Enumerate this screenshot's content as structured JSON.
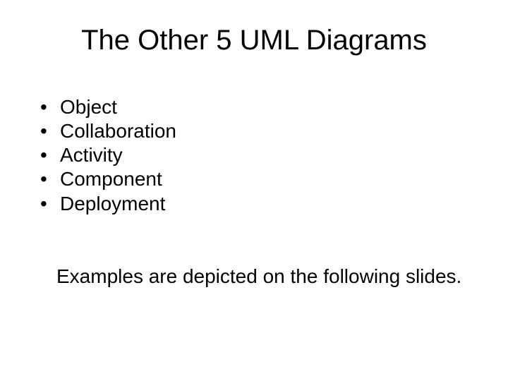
{
  "title": "The Other 5 UML Diagrams",
  "bullets": {
    "b0": "Object",
    "b1": "Collaboration",
    "b2": "Activity",
    "b3": "Component",
    "b4": "Deployment"
  },
  "footer": "Examples are depicted on the following slides."
}
